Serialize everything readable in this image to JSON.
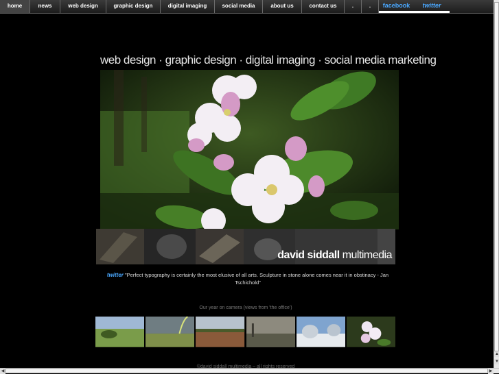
{
  "nav": {
    "items": [
      {
        "label": "home"
      },
      {
        "label": "news"
      },
      {
        "label": "web design"
      },
      {
        "label": "graphic design"
      },
      {
        "label": "digital imaging"
      },
      {
        "label": "social media"
      },
      {
        "label": "about us"
      },
      {
        "label": "contact us"
      },
      {
        "label": "."
      },
      {
        "label": "."
      }
    ],
    "facebook": "facebook",
    "twitter": "twitter"
  },
  "header": {
    "tagline": "web design · graphic design · digital imaging · social media marketing"
  },
  "banner": {
    "brand_bold": "david siddall",
    "brand_light": "multimedia"
  },
  "quote": {
    "source": "twitter",
    "text": "\"Perfect typography is certainly the most elusive of all arts. Sculpture in stone alone comes near it in obstinacy - Jan Tschichold\""
  },
  "gallery": {
    "caption": "Our year on camera (views from 'the office')"
  },
  "footer": {
    "text": "©david siddall multimedia – all rights reserved"
  },
  "colors": {
    "background": "#000000",
    "link_blue": "#4aa8ff",
    "nav_bar": "#2b2b2b"
  }
}
